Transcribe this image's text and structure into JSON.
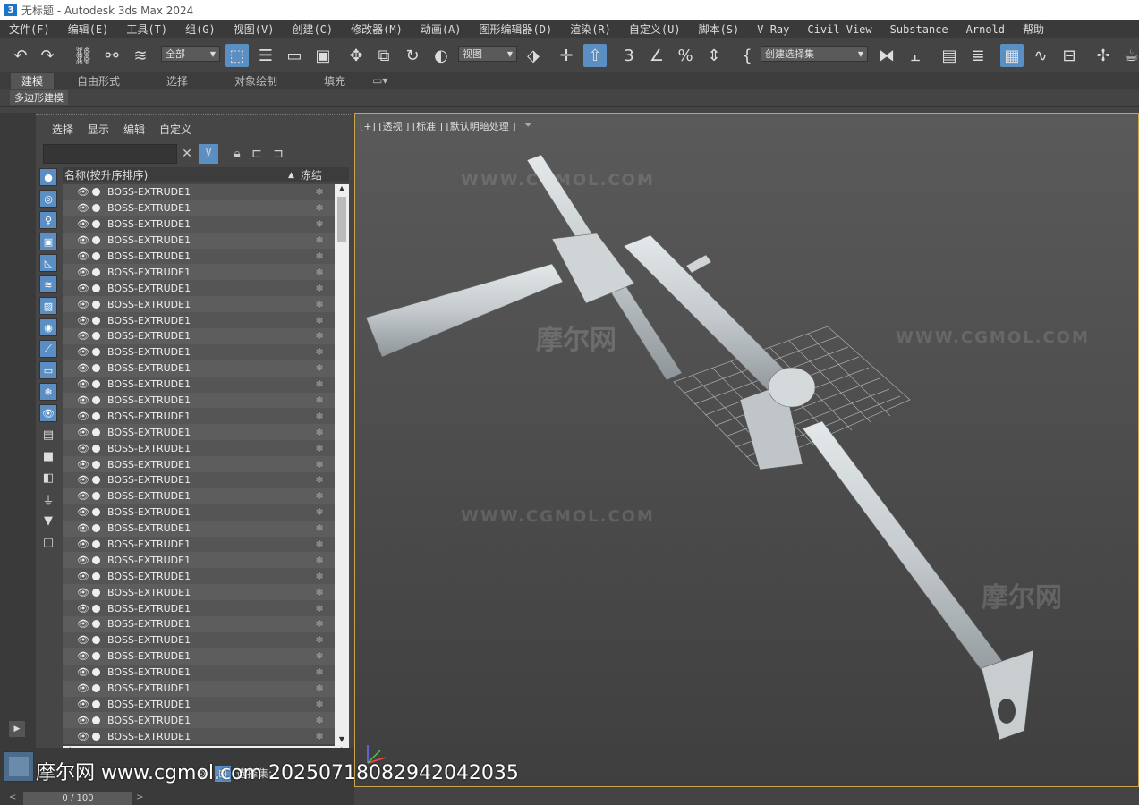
{
  "window": {
    "app_number": "3",
    "title": "无标题 - Autodesk 3ds Max 2024"
  },
  "menu": [
    "文件(F)",
    "编辑(E)",
    "工具(T)",
    "组(G)",
    "视图(V)",
    "创建(C)",
    "修改器(M)",
    "动画(A)",
    "图形编辑器(D)",
    "渲染(R)",
    "自定义(U)",
    "脚本(S)",
    "V-Ray",
    "Civil View",
    "Substance",
    "Arnold",
    "帮助"
  ],
  "toolbar": {
    "selection_filter": "全部",
    "reference_coord": "视图",
    "named_selection": "创建选择集"
  },
  "ribbon": {
    "tabs": [
      "建模",
      "自由形式",
      "选择",
      "对象绘制",
      "填充"
    ],
    "active_tab": 0,
    "subpanel": "多边形建模"
  },
  "explorer": {
    "menu": [
      "选择",
      "显示",
      "编辑",
      "自定义"
    ],
    "search_value": "",
    "header_name": "名称(按升序排序)",
    "header_sort": "▲",
    "header_freeze": "冻结",
    "row_name": "BOSS-EXTRUDE1",
    "rows": [
      "BOSS-EXTRUDE1",
      "BOSS-EXTRUDE1",
      "BOSS-EXTRUDE1",
      "BOSS-EXTRUDE1",
      "BOSS-EXTRUDE1",
      "BOSS-EXTRUDE1",
      "BOSS-EXTRUDE1",
      "BOSS-EXTRUDE1",
      "BOSS-EXTRUDE1",
      "BOSS-EXTRUDE1",
      "BOSS-EXTRUDE1",
      "BOSS-EXTRUDE1",
      "BOSS-EXTRUDE1",
      "BOSS-EXTRUDE1",
      "BOSS-EXTRUDE1",
      "BOSS-EXTRUDE1",
      "BOSS-EXTRUDE1",
      "BOSS-EXTRUDE1",
      "BOSS-EXTRUDE1",
      "BOSS-EXTRUDE1",
      "BOSS-EXTRUDE1",
      "BOSS-EXTRUDE1",
      "BOSS-EXTRUDE1",
      "BOSS-EXTRUDE1",
      "BOSS-EXTRUDE1",
      "BOSS-EXTRUDE1",
      "BOSS-EXTRUDE1",
      "BOSS-EXTRUDE1",
      "BOSS-EXTRUDE1",
      "BOSS-EXTRUDE1",
      "BOSS-EXTRUDE1",
      "BOSS-EXTRUDE1",
      "BOSS-EXTRUDE1",
      "BOSS-EXTRUDE1",
      "BOSS-EXTRUDE1"
    ]
  },
  "viewport": {
    "label": "[+] [透视 ] [标准 ] [默认明暗处理 ]",
    "watermark_url": "WWW.CGMOL.COM",
    "watermark_cn": "摩尔网"
  },
  "statusbar": {
    "overlay_text": "摩尔网 www.cgmol.com 20250718082942042035",
    "selection_label": "选择集:"
  },
  "timeline": {
    "frame": "0 / 100"
  },
  "colors": {
    "accent": "#5b8fc4",
    "viewport_border": "#c9a64a"
  }
}
